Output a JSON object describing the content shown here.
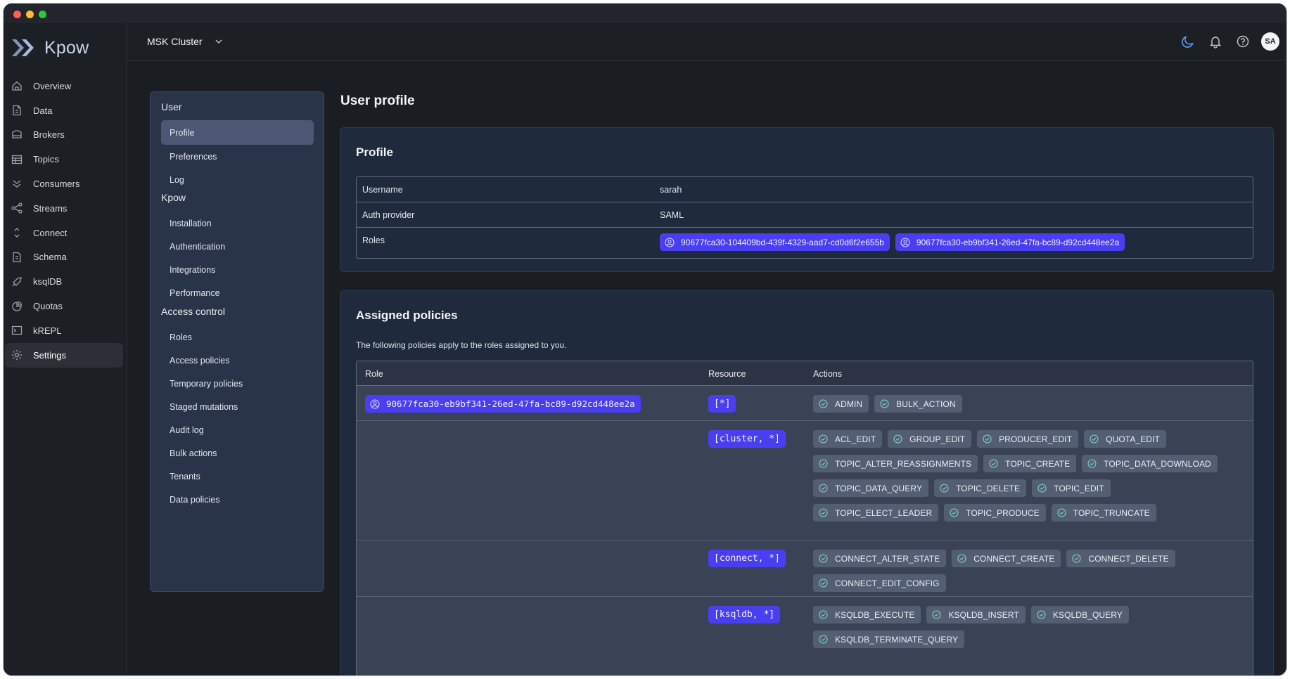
{
  "app": {
    "brand": "Kpow"
  },
  "sidebar": {
    "items": [
      {
        "label": "Overview",
        "icon": "home-icon"
      },
      {
        "label": "Data",
        "icon": "document-icon"
      },
      {
        "label": "Brokers",
        "icon": "server-icon"
      },
      {
        "label": "Topics",
        "icon": "table-icon"
      },
      {
        "label": "Consumers",
        "icon": "consumers-icon"
      },
      {
        "label": "Streams",
        "icon": "share-icon"
      },
      {
        "label": "Connect",
        "icon": "connect-icon"
      },
      {
        "label": "Schema",
        "icon": "schema-icon"
      },
      {
        "label": "ksqlDB",
        "icon": "rocket-icon"
      },
      {
        "label": "Quotas",
        "icon": "pie-icon"
      },
      {
        "label": "kREPL",
        "icon": "terminal-icon"
      },
      {
        "label": "Settings",
        "icon": "gear-icon",
        "active": true
      }
    ]
  },
  "topbar": {
    "cluster": "MSK Cluster",
    "avatar": "SA",
    "icons": [
      "moon-icon",
      "bell-icon",
      "help-icon"
    ]
  },
  "settings_menu": {
    "sections": [
      {
        "title": "User",
        "items": [
          "Profile",
          "Preferences",
          "Log"
        ]
      },
      {
        "title": "Kpow",
        "items": [
          "Installation",
          "Authentication",
          "Integrations",
          "Performance"
        ]
      },
      {
        "title": "Access control",
        "items": [
          "Roles",
          "Access policies",
          "Temporary policies",
          "Staged mutations",
          "Audit log",
          "Bulk actions",
          "Tenants",
          "Data policies"
        ]
      }
    ],
    "active": "Profile"
  },
  "page": {
    "title": "User profile"
  },
  "profile": {
    "title": "Profile",
    "rows": [
      {
        "key": "Username",
        "value": "sarah"
      },
      {
        "key": "Auth provider",
        "value": "SAML"
      }
    ],
    "roles_label": "Roles",
    "roles": [
      "90677fca30-104409bd-439f-4329-aad7-cd0d6f2e655b",
      "90677fca30-eb9bf341-26ed-47fa-bc89-d92cd448ee2a"
    ]
  },
  "policies": {
    "title": "Assigned policies",
    "description": "The following policies apply to the roles assigned to you.",
    "headers": {
      "role": "Role",
      "resource": "Resource",
      "actions": "Actions"
    },
    "role": "90677fca30-eb9bf341-26ed-47fa-bc89-d92cd448ee2a",
    "groups": [
      {
        "resource": "[*]",
        "actions": [
          "ADMIN",
          "BULK_ACTION"
        ]
      },
      {
        "resource": "[cluster, *]",
        "actions": [
          "ACL_EDIT",
          "GROUP_EDIT",
          "PRODUCER_EDIT",
          "QUOTA_EDIT",
          "TOPIC_ALTER_REASSIGNMENTS",
          "TOPIC_CREATE",
          "TOPIC_DATA_DOWNLOAD",
          "TOPIC_DATA_QUERY",
          "TOPIC_DELETE",
          "TOPIC_EDIT",
          "TOPIC_ELECT_LEADER",
          "TOPIC_PRODUCE",
          "TOPIC_TRUNCATE"
        ]
      },
      {
        "resource": "[connect, *]",
        "actions": [
          "CONNECT_ALTER_STATE",
          "CONNECT_CREATE",
          "CONNECT_DELETE",
          "CONNECT_EDIT_CONFIG"
        ]
      },
      {
        "resource": "[ksqldb, *]",
        "actions": [
          "KSQLDB_EXECUTE",
          "KSQLDB_INSERT",
          "KSQLDB_QUERY",
          "KSQLDB_TERMINATE_QUERY"
        ]
      }
    ]
  },
  "colors": {
    "accent": "#4a3ff0",
    "background": "#1a1d22",
    "card": "#1f2a3d",
    "menu": "#2a3448"
  }
}
